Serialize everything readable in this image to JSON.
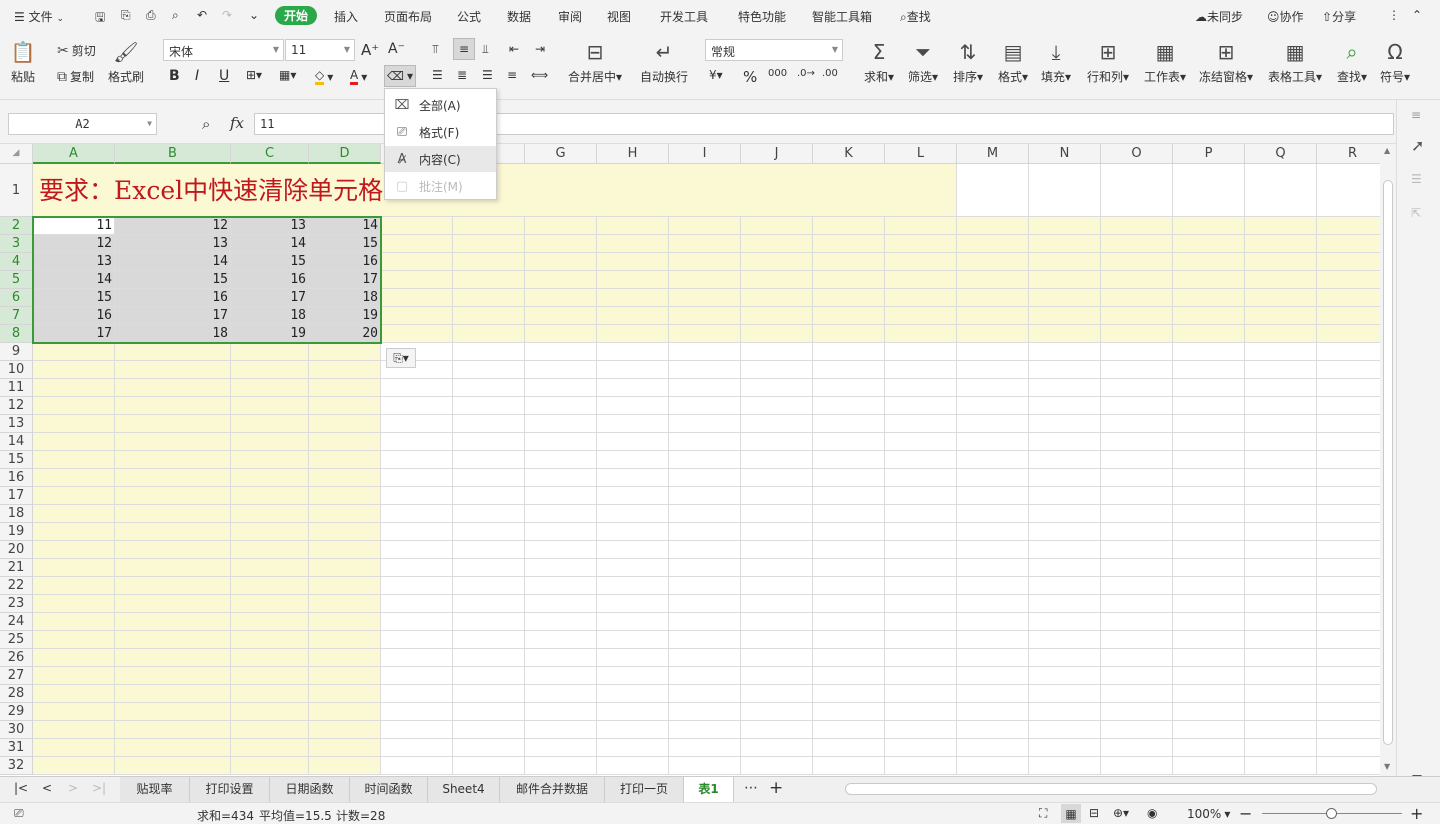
{
  "menubar": {
    "file": "文件",
    "tabs": [
      "开始",
      "插入",
      "页面布局",
      "公式",
      "数据",
      "审阅",
      "视图",
      "开发工具",
      "特色功能",
      "智能工具箱"
    ],
    "search": "查找",
    "sync": "未同步",
    "collab": "协作",
    "share": "分享"
  },
  "ribbon": {
    "paste": "粘贴",
    "cut": "剪切",
    "copy": "复制",
    "format_painter": "格式刷",
    "font_name": "宋体",
    "font_size": "11",
    "merge_center": "合并居中",
    "wrap_text": "自动换行",
    "number_format": "常规",
    "sum": "求和",
    "filter": "筛选",
    "sort": "排序",
    "format": "格式",
    "fill": "填充",
    "row_col": "行和列",
    "worksheet": "工作表",
    "freeze": "冻结窗格",
    "table_tools": "表格工具",
    "find": "查找",
    "symbol": "符号"
  },
  "formula_bar": {
    "name_box": "A2",
    "fx": "fx",
    "value": "11"
  },
  "clear_menu": {
    "items": [
      {
        "label": "全部(A)",
        "enabled": true
      },
      {
        "label": "格式(F)",
        "enabled": true
      },
      {
        "label": "内容(C)",
        "enabled": true,
        "hover": true
      },
      {
        "label": "批注(M)",
        "enabled": false
      }
    ]
  },
  "sheet": {
    "columns": [
      "A",
      "B",
      "C",
      "D",
      "E",
      "F",
      "G",
      "H",
      "I",
      "J",
      "K",
      "L",
      "M",
      "N",
      "O",
      "P",
      "Q",
      "R"
    ],
    "rows": [
      "1",
      "2",
      "3",
      "4",
      "5",
      "6",
      "7",
      "8",
      "9",
      "10",
      "11",
      "12",
      "13",
      "14",
      "15",
      "16",
      "17",
      "18",
      "19",
      "20",
      "21",
      "22",
      "23",
      "24",
      "25",
      "26",
      "27",
      "28",
      "29",
      "30",
      "31",
      "32"
    ],
    "title_text": "要求：Excel中快速清除单元格",
    "data": [
      [
        "11",
        "12",
        "13",
        "14"
      ],
      [
        "12",
        "13",
        "14",
        "15"
      ],
      [
        "13",
        "14",
        "15",
        "16"
      ],
      [
        "14",
        "15",
        "16",
        "17"
      ],
      [
        "15",
        "16",
        "17",
        "18"
      ],
      [
        "16",
        "17",
        "18",
        "19"
      ],
      [
        "17",
        "18",
        "19",
        "20"
      ]
    ],
    "colors": {
      "fill_yellow": "#fbf8d4",
      "selected": "#d9d9d9",
      "title_red": "#c0181d",
      "select_border": "#3a9a3a"
    }
  },
  "sheet_tabs": [
    "贴现率",
    "打印设置",
    "日期函数",
    "时间函数",
    "Sheet4",
    "邮件合并数据",
    "打印一页",
    "表1"
  ],
  "active_tab": "表1",
  "status": {
    "sum": "求和=434",
    "avg": "平均值=15.5",
    "count": "计数=28",
    "zoom": "100%"
  }
}
